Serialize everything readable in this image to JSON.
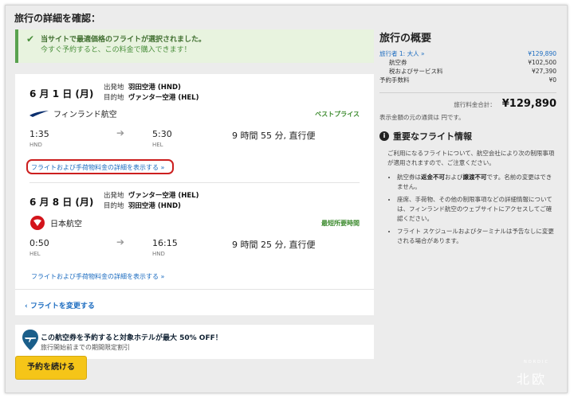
{
  "page": {
    "title": "旅行の詳細を確認："
  },
  "banner": {
    "line1": "当サイトで最適価格のフライトが選択されました。",
    "line2": "今すぐ予約すると、この料金で購入できます！"
  },
  "outbound": {
    "date": "6 月 1 日 (月)",
    "from_label": "出発地",
    "from_value": "羽田空港 (HND)",
    "to_label": "目的地",
    "to_value": "ヴァンター空港 (HEL)",
    "airline": "フィンランド航空",
    "tag": "ベストプライス",
    "dep_time": "1:35",
    "dep_code": "HND",
    "arr_time": "5:30",
    "arr_code": "HEL",
    "duration": "9 時間 55 分, 直行便",
    "details_link": "フライトおよび手荷物料金の詳細を表示する",
    "details_chevron": "»"
  },
  "return": {
    "date": "6 月 8 日 (月)",
    "from_label": "出発地",
    "from_value": "ヴァンター空港 (HEL)",
    "to_label": "目的地",
    "to_value": "羽田空港 (HND)",
    "airline": "日本航空",
    "tag": "最短所要時間",
    "dep_time": "0:50",
    "dep_code": "HEL",
    "arr_time": "16:15",
    "arr_code": "HND",
    "duration": "9 時間 25 分, 直行便",
    "details_link": "フライトおよび手荷物料金の詳細を表示する",
    "details_chevron": "»"
  },
  "change_flight": "フライトを変更する",
  "hotel": {
    "line1": "この航空券を予約すると対象ホテルが最大 50% OFF！",
    "line2": "旅行開始前までの期間限定割引"
  },
  "continue_button": "予約を続ける",
  "summary": {
    "title": "旅行の概要",
    "traveler_label": "旅行者 1: 大人",
    "traveler_value": "¥129,890",
    "fare_label": "航空券",
    "fare_value": "¥102,500",
    "tax_label": "税およびサービス料",
    "tax_value": "¥27,390",
    "booking_fee_label": "予約手数料",
    "booking_fee_value": "¥0",
    "total_label": "旅行料金合計：",
    "total_value": "¥129,890",
    "currency_note": "表示金額の元の通貨は 円です。"
  },
  "info": {
    "title": "重要なフライト情報",
    "intro": "ご利用になるフライトについて、航空会社により次の制限事項が適用されますので、ご注意ください。",
    "b1_pre": "航空券は",
    "b1_bold1": "返金不可",
    "b1_mid": "および",
    "b1_bold2": "譲渡不可",
    "b1_post": "です。名前の変更はできません。",
    "b2": "座席、手荷物、その他の制限事項などの詳細情報については、フィンランド航空のウェブサイトにアクセスしてご確認ください。",
    "b3": "フライト スケジュールおよびターミナルは予告なしに変更される場合があります。"
  },
  "watermark": {
    "text": "北欧",
    "sub": "NORDIC"
  },
  "colors": {
    "accent_link": "#1c6cc0",
    "success": "#59a14f",
    "button": "#f5c518",
    "highlight": "#cc1f1f"
  }
}
